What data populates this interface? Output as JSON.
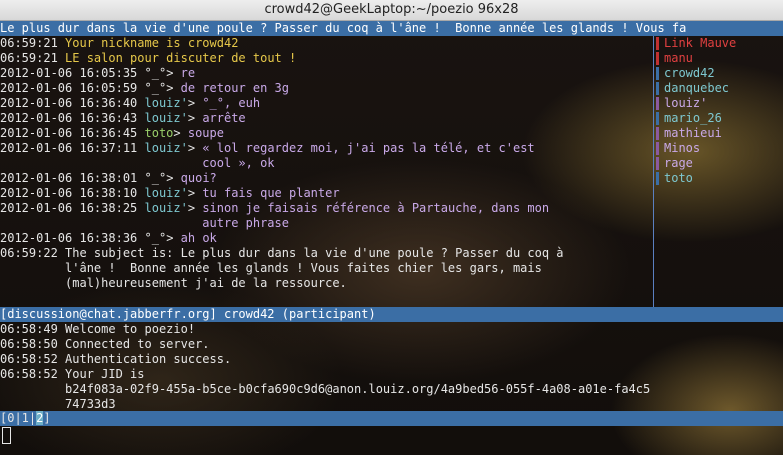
{
  "window": {
    "title": "crowd42@GeekLaptop:~/poezio 96x28"
  },
  "topic_bar": "Le plus dur dans la vie d'une poule ? Passer du coq à l'âne !  Bonne année les glands ! Vous fa",
  "messages": [
    {
      "ts": "06:59:21",
      "nick": "",
      "text": "Your nickname is ",
      "extra": "crowd42",
      "color_text": "#e6c84a"
    },
    {
      "ts": "06:59:21",
      "nick": "",
      "text": "LE salon pour discuter de tout !",
      "color_text": "#e6c84a"
    },
    {
      "ts": "2012-01-06 16:05:35",
      "nick": "°_°",
      "sep": "> ",
      "text": "re"
    },
    {
      "ts": "2012-01-06 16:05:59",
      "nick": "°_°",
      "sep": "> ",
      "text": "de retour en 3g"
    },
    {
      "ts": "2012-01-06 16:36:40",
      "nick": "louiz'",
      "sep": "> ",
      "text": "°_°, euh"
    },
    {
      "ts": "2012-01-06 16:36:43",
      "nick": "louiz'",
      "sep": "> ",
      "text": "arrête"
    },
    {
      "ts": "2012-01-06 16:36:45",
      "nick": "toto",
      "sep": "> ",
      "text": "soupe"
    },
    {
      "ts": "2012-01-06 16:37:11",
      "nick": "louiz'",
      "sep": "> ",
      "text": "« lol regardez moi, j'ai pas la télé, et c'est",
      "cont": "cool », ok"
    },
    {
      "ts": "2012-01-06 16:38:01",
      "nick": "°_°",
      "sep": "> ",
      "text": "quoi?"
    },
    {
      "ts": "2012-01-06 16:38:10",
      "nick": "louiz'",
      "sep": "> ",
      "text": "tu fais que planter"
    },
    {
      "ts": "2012-01-06 16:38:25",
      "nick": "louiz'",
      "sep": "> ",
      "text": "sinon je faisais référence à Partauche, dans mon",
      "cont": "autre phrase"
    },
    {
      "ts": "2012-01-06 16:38:36",
      "nick": "°_°",
      "sep": "> ",
      "text": "ah ok"
    },
    {
      "ts": "06:59:22",
      "nick": "",
      "text": "The subject is: Le plus dur dans la vie d'une poule ? Passer du coq à",
      "cont": "l'âne !  Bonne année les glands ! Vous faites chier les gars, mais",
      "cont2": "(mal)heureusement j'ai de la ressource."
    }
  ],
  "roster": [
    {
      "name": "Link Mauve",
      "color": "#e04040"
    },
    {
      "name": "manu",
      "color": "#e04040"
    },
    {
      "name": "crowd42",
      "color": "#7ec8d0"
    },
    {
      "name": "danquebec",
      "color": "#7ec8d0"
    },
    {
      "name": "louiz'",
      "color": "#c9a9e8"
    },
    {
      "name": "mario_26",
      "color": "#7ec8d0"
    },
    {
      "name": "mathieui",
      "color": "#c9a9e8"
    },
    {
      "name": "Minos",
      "color": "#c9a9e8"
    },
    {
      "name": "rage",
      "color": "#c9a9e8"
    },
    {
      "name": "toto",
      "color": "#7ec8d0"
    }
  ],
  "info_bar": "[discussion@chat.jabberfr.org] crowd42 (participant)",
  "info_messages": [
    {
      "ts": "06:58:49",
      "text": "Welcome to poezio!"
    },
    {
      "ts": "06:58:50",
      "text": "Connected to server."
    },
    {
      "ts": "06:58:52",
      "text": "Authentication success."
    },
    {
      "ts": "06:58:52",
      "text": "Your JID is"
    },
    {
      "ts": "",
      "text": "b24f083a-02f9-455a-b5ce-b0cfa690c9d6@anon.louiz.org/4a9bed56-055f-4a08-a01e-fa4c5"
    },
    {
      "ts": "",
      "text": "74733d3"
    }
  ],
  "tabs": {
    "pre": "[0|1|",
    "current": "2",
    "post": "]"
  }
}
